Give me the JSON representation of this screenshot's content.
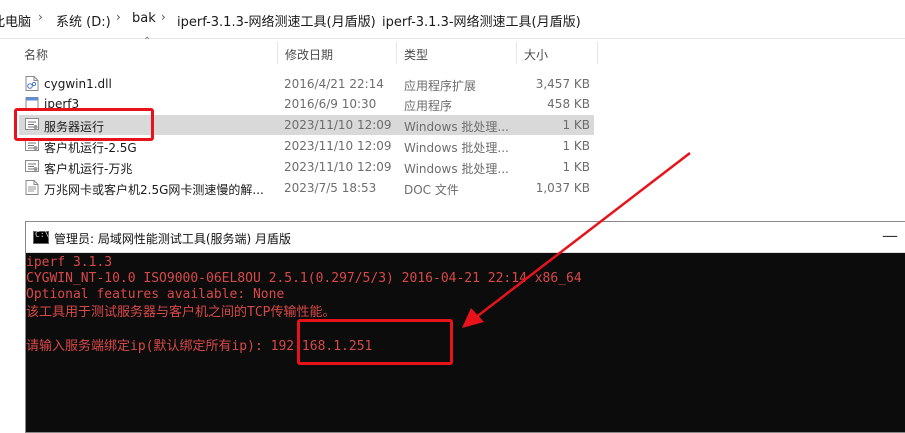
{
  "breadcrumb": {
    "items": [
      "此电脑",
      "系统 (D:)",
      "bak",
      "iperf-3.1.3-网络测速工具(月盾版)",
      "iperf-3.1.3-网络测速工具(月盾版)"
    ],
    "chevron": "›"
  },
  "columns": {
    "name": "名称",
    "date": "修改日期",
    "type": "类型",
    "size": "大小"
  },
  "files": [
    {
      "name": "cygwin1.dll",
      "date": "2016/4/21 22:14",
      "type": "应用程序扩展",
      "size": "3,457 KB",
      "icon": "dll-file-icon"
    },
    {
      "name": "iperf3",
      "date": "2016/6/9 10:30",
      "type": "应用程序",
      "size": "458 KB",
      "icon": "exe-file-icon"
    },
    {
      "name": "服务器运行",
      "date": "2023/11/10 12:09",
      "type": "Windows 批处理...",
      "size": "1 KB",
      "icon": "batch-file-icon"
    },
    {
      "name": "客户机运行-2.5G",
      "date": "2023/11/10 12:09",
      "type": "Windows 批处理...",
      "size": "1 KB",
      "icon": "batch-file-icon"
    },
    {
      "name": "客户机运行-万兆",
      "date": "2023/11/10 12:09",
      "type": "Windows 批处理...",
      "size": "1 KB",
      "icon": "batch-file-icon"
    },
    {
      "name": "万兆网卡或客户机2.5G网卡测速慢的解...",
      "date": "2023/7/5 18:53",
      "type": "DOC 文件",
      "size": "1,037 KB",
      "icon": "doc-file-icon"
    }
  ],
  "console": {
    "title": "管理员:  局域网性能测试工具(服务端)  月盾版",
    "lines": [
      "iperf 3.1.3",
      "CYGWIN_NT-10.0 ISO9000-06EL8OU 2.5.1(0.297/5/3) 2016-04-21 22:14 x86_64",
      "Optional features available: None",
      "该工具用于测试服务器与客户机之间的TCP传输性能。",
      "",
      "请输入服务端绑定ip(默认绑定所有ip): 192.168.1.251"
    ],
    "minimize": "—"
  },
  "colors": {
    "annotation": "#e8131a",
    "console_text": "#d94848",
    "selection": "#d9d9d9"
  }
}
